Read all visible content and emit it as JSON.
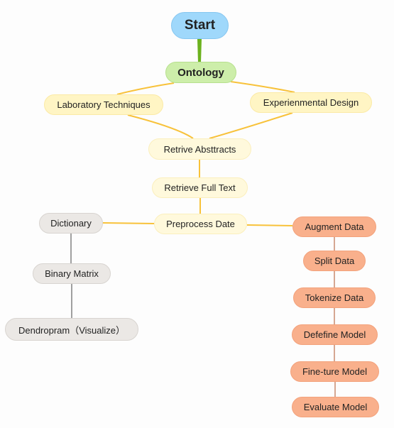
{
  "colors": {
    "start": "#9fd8fb",
    "ontology": "#cdeeaa",
    "yellow": "#fff5c4",
    "gray": "#ebe8e5",
    "orange": "#f9b08c",
    "edge_yellow": "#f8c23a",
    "edge_gray": "#808080",
    "edge_orange": "#c98a6e",
    "edge_green": "#6cb21e"
  },
  "nodes": {
    "start": "Start",
    "ontology": "Ontology",
    "lab": "Laboratory Techniques",
    "exp": "Experienmental Design",
    "abstracts": "Retrive Absttracts",
    "fulltext": "Retrieve Full Text",
    "preprocess": "Preprocess Date",
    "dictionary": "Dictionary",
    "binary": "Binary Matrix",
    "dendro": "Dendropram（Visualize）",
    "augment": "Augment Data",
    "split": "Split Data",
    "tokenize": "Tokenize Data",
    "define": "Defefine Model",
    "finetune": "Fine-ture Model",
    "evaluate": "Evaluate Model"
  }
}
